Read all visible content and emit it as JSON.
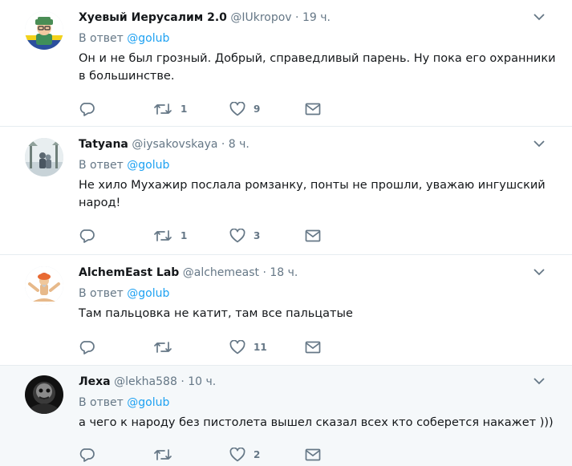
{
  "tweets": [
    {
      "name": "Хуевый Иерусалим 2.0",
      "handle": "@IUkropov",
      "time": "19 ч.",
      "reply_prefix": "В ответ",
      "reply_mention": "@golub",
      "text": "Он и не был грозный. Добрый, справедливый парень. Ну пока его охранники в большинстве.",
      "retweets": "1",
      "likes": "9"
    },
    {
      "name": "Tatyana",
      "handle": "@iysakovskaya",
      "time": "8 ч.",
      "reply_prefix": "В ответ",
      "reply_mention": "@golub",
      "text": "Не хило Мухажир послала ромзанку, понты не прошли, уважаю ингушский народ!",
      "retweets": "1",
      "likes": "3"
    },
    {
      "name": "AlchemEast Lab",
      "handle": "@alchemeast",
      "time": "18 ч.",
      "reply_prefix": "В ответ",
      "reply_mention": "@golub",
      "text": "Там пальцовка не катит, там все пальцатые",
      "retweets": "",
      "likes": "11"
    },
    {
      "name": "Леха",
      "handle": "@lekha588",
      "time": "10 ч.",
      "reply_prefix": "В ответ",
      "reply_mention": "@golub",
      "text": "а чего к народу без пистолета вышел сказал всех кто соберется накажет )))",
      "retweets": "",
      "likes": "2"
    }
  ],
  "separator": "·",
  "icons": {
    "reply": "reply-icon",
    "retweet": "retweet-icon",
    "like": "heart-icon",
    "dm": "envelope-icon",
    "menu": "chevron-down-icon"
  },
  "colors": {
    "link": "#1da1f2",
    "muted": "#657786",
    "text": "#14171a",
    "hover_bg": "#f5f8fa",
    "border": "#e6ecf0"
  }
}
